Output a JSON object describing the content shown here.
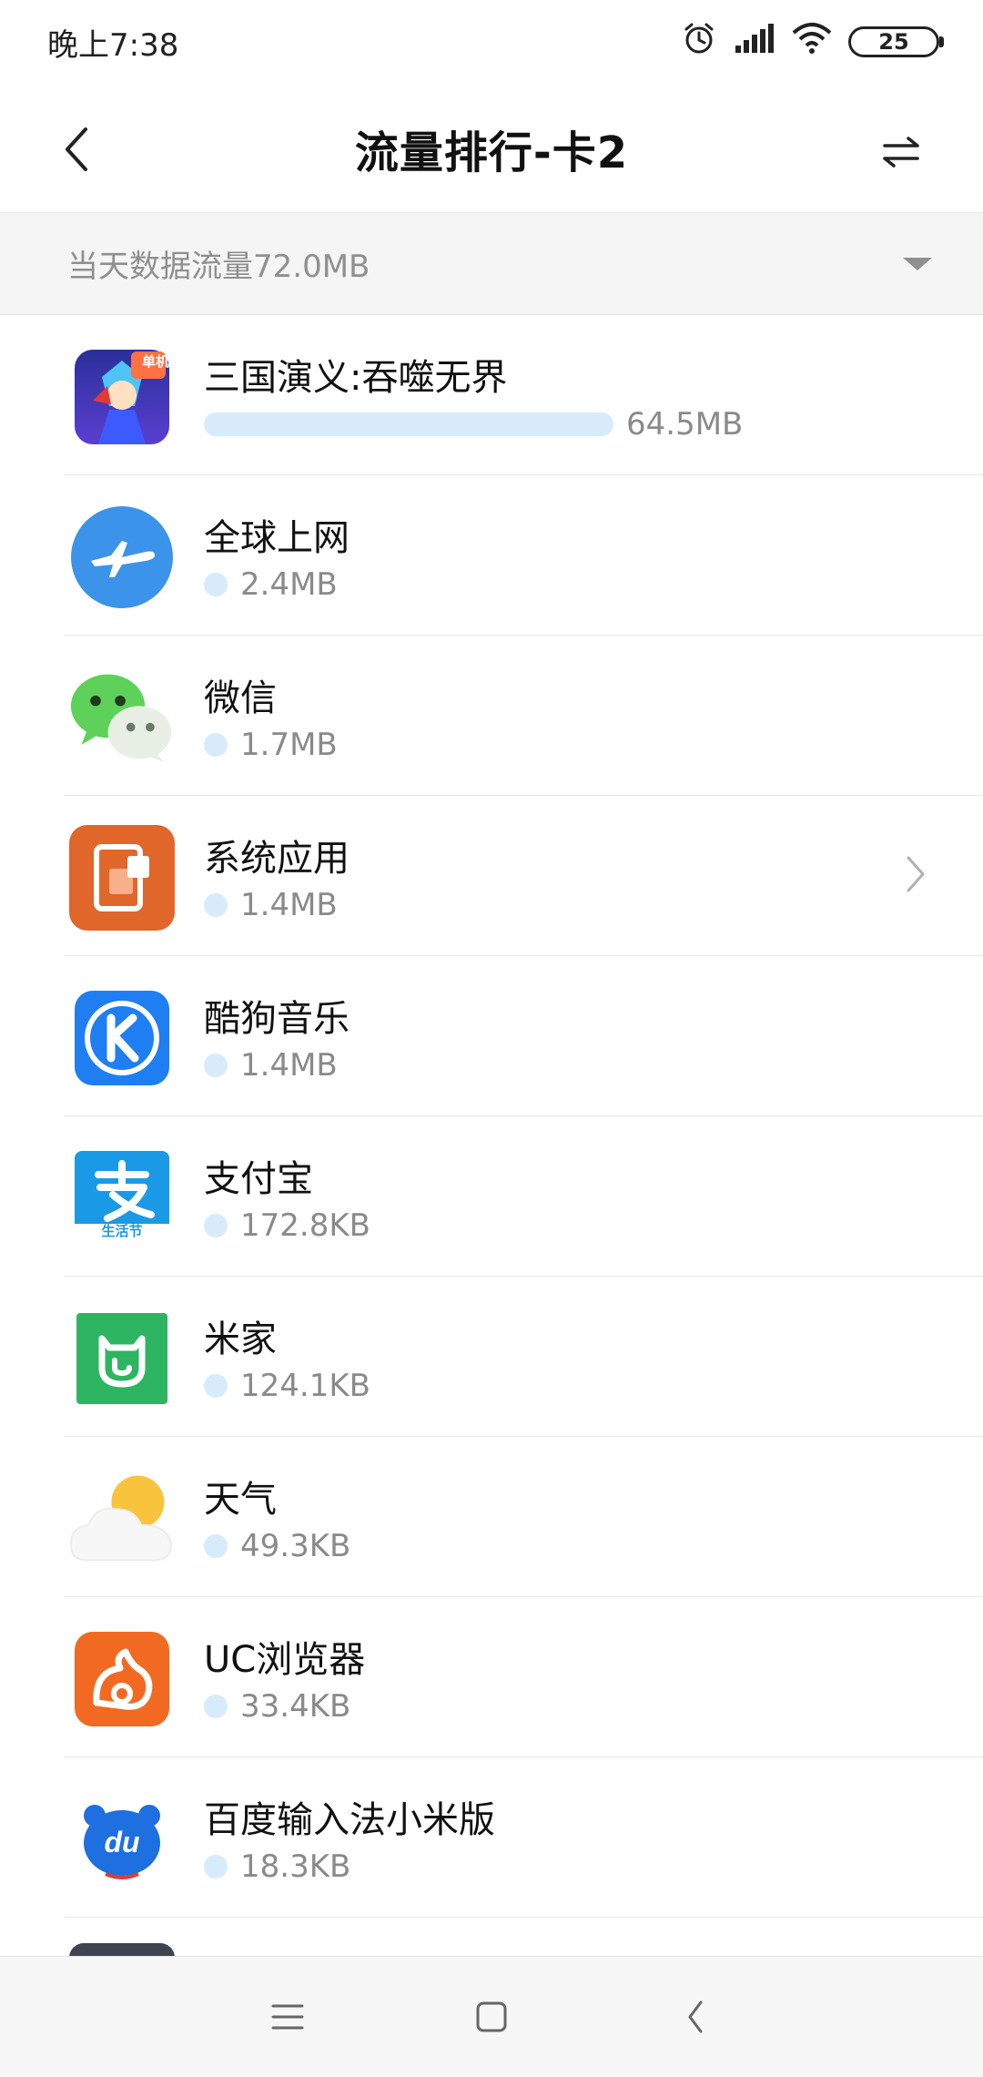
{
  "status_bar": {
    "time": "晚上7:38",
    "battery": "25"
  },
  "app_bar": {
    "title": "流量排行-卡2"
  },
  "summary": {
    "text": "当天数据流量72.0MB"
  },
  "items": [
    {
      "name": "三国演义:吞噬无界",
      "usage": "64.5MB",
      "fraction": 0.9
    },
    {
      "name": "全球上网",
      "usage": "2.4MB",
      "fraction": 0.03
    },
    {
      "name": "微信",
      "usage": "1.7MB",
      "fraction": 0.02
    },
    {
      "name": "系统应用",
      "usage": "1.4MB",
      "fraction": 0.02
    },
    {
      "name": "酷狗音乐",
      "usage": "1.4MB",
      "fraction": 0.02
    },
    {
      "name": "支付宝",
      "usage": "172.8KB",
      "fraction": 0.002
    },
    {
      "name": "米家",
      "usage": "124.1KB",
      "fraction": 0.002
    },
    {
      "name": "天气",
      "usage": "49.3KB",
      "fraction": 0.001
    },
    {
      "name": "UC浏览器",
      "usage": "33.4KB",
      "fraction": 0.001
    },
    {
      "name": "百度输入法小米版",
      "usage": "18.3KB",
      "fraction": 0.001
    }
  ],
  "alipay_icon_label": "生活节",
  "game_icon_badge": "单机",
  "colors": {
    "usage_bar": "#d7ebfb",
    "global_net": "#3b93ea",
    "wechat": "#5dd15a",
    "system_app": "#e0662a",
    "kugou": "#1f7ef2",
    "alipay": "#1a9ae6",
    "mijia": "#2eb562",
    "uc": "#f26a21",
    "baidu_ime": "#1e6fe0"
  }
}
